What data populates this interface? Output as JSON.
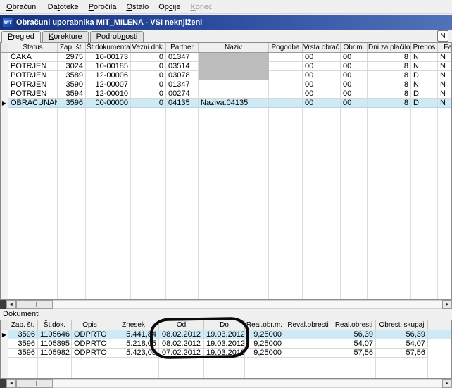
{
  "menu": {
    "items": [
      {
        "label": "Obračuni",
        "hotkey": "O",
        "enabled": true
      },
      {
        "label": "Datoteke",
        "hotkey": "t",
        "enabled": true
      },
      {
        "label": "Poročila",
        "hotkey": "P",
        "enabled": true
      },
      {
        "label": "Ostalo",
        "hotkey": "O",
        "enabled": true
      },
      {
        "label": "Opcije",
        "hotkey": "c",
        "enabled": true
      },
      {
        "label": "Konec",
        "hotkey": "K",
        "enabled": false
      }
    ]
  },
  "window": {
    "logo_text": "MIT",
    "title": "Obračuni uporabnika MIT_MILENA - VSI neknjiženi"
  },
  "tabs": [
    {
      "label": "Pregled",
      "hotkey": "P",
      "active": true
    },
    {
      "label": "Korekture",
      "hotkey": "K",
      "active": false
    },
    {
      "label": "Podrobnosti",
      "hotkey": "n",
      "active": false
    }
  ],
  "n_button_label": "N",
  "main_grid": {
    "columns": [
      "Status",
      "Zap. št.",
      "Št.dokumenta",
      "Vezni dok.",
      "Partner",
      "Naziv",
      "Pogodba",
      "Vrsta obrač.",
      "Obr.m.",
      "Dni za plačilo",
      "Prenos",
      "Fakturira"
    ],
    "rows": [
      {
        "cells": [
          "ČAKA",
          "2975",
          "10-00173",
          "0",
          "01347",
          "",
          "",
          "00",
          "00",
          "8",
          "N",
          "N"
        ],
        "selected": false,
        "naziv_redacted": true
      },
      {
        "cells": [
          "POTRJEN",
          "3024",
          "10-00185",
          "0",
          "03514",
          "",
          "",
          "00",
          "00",
          "8",
          "N",
          "N"
        ],
        "selected": false,
        "naziv_redacted": true
      },
      {
        "cells": [
          "POTRJEN",
          "3589",
          "12-00006",
          "0",
          "03078",
          "",
          "",
          "00",
          "00",
          "8",
          "D",
          "N"
        ],
        "selected": false,
        "naziv_redacted": true
      },
      {
        "cells": [
          "POTRJEN",
          "3590",
          "12-00007",
          "0",
          "01347",
          "",
          "",
          "00",
          "00",
          "8",
          "N",
          "N"
        ],
        "selected": false,
        "naziv_redacted": false
      },
      {
        "cells": [
          "POTRJEN",
          "3594",
          "12-00010",
          "0",
          "00274",
          "",
          "",
          "00",
          "00",
          "8",
          "D",
          "N"
        ],
        "selected": false,
        "naziv_redacted": false
      },
      {
        "cells": [
          "OBRAČUNAN",
          "3596",
          "00-00000",
          "0",
          "04135",
          "Naziva:04135",
          "",
          "00",
          "00",
          "8",
          "D",
          "N"
        ],
        "selected": true,
        "naziv_redacted": false
      }
    ]
  },
  "documents_label": "Dokumenti",
  "doc_grid": {
    "columns": [
      "Zap. št.",
      "Št.dok.",
      "Opis",
      "Znesek",
      "Od",
      "Do",
      "Real.obr.m.",
      "Reval.obresti",
      "Real.obresti",
      "Obresti skupaj"
    ],
    "rows": [
      {
        "cells": [
          "3596",
          "1105646",
          "ODPRTO",
          "5.441,84",
          "08.02.2012",
          "19.03.2012",
          "9,25000",
          "",
          "56,39",
          "56,39"
        ],
        "selected": true
      },
      {
        "cells": [
          "3596",
          "1105895",
          "ODPRTO",
          "5.218,05",
          "08.02.2012",
          "19.03.2012",
          "9,25000",
          "",
          "54,07",
          "54,07"
        ],
        "selected": false
      },
      {
        "cells": [
          "3596",
          "1105982",
          "ODPRTO",
          "5.423,05",
          "07.02.2012",
          "19.03.2012",
          "9,25000",
          "",
          "57,56",
          "57,56"
        ],
        "selected": false
      }
    ]
  },
  "icons": {
    "scroll_left": "◄",
    "scroll_right": "►",
    "row_marker": "▶",
    "thumb_grip": "grip-lines"
  },
  "colors": {
    "titlebar_blue": "#2a4b9d",
    "selected_row": "#cdeaf6",
    "redaction_gray": "#bcbcbc",
    "annotation_black": "#0a0a0a"
  }
}
